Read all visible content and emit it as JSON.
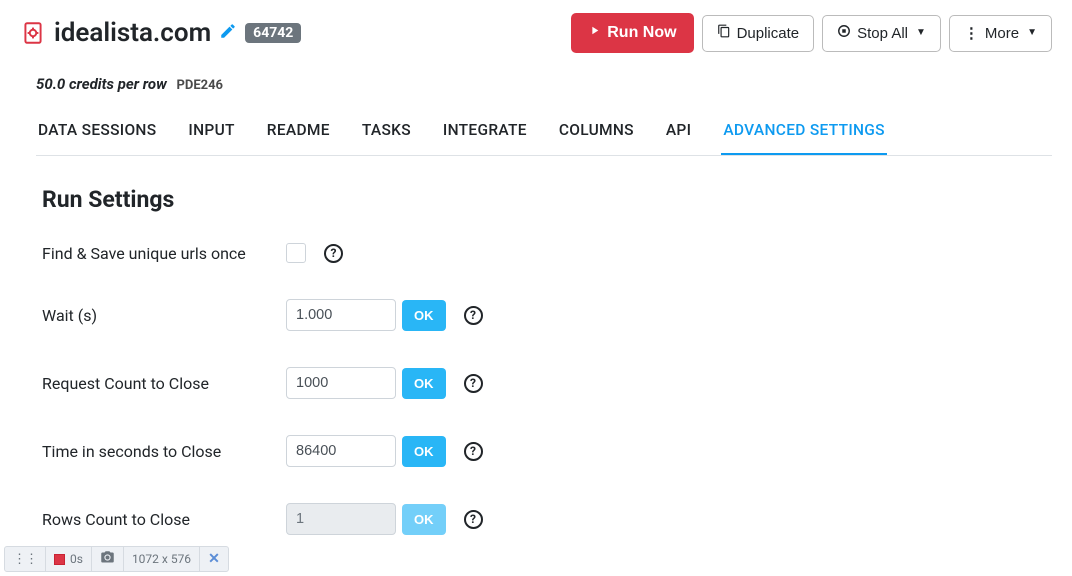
{
  "header": {
    "site_title": "idealista.com",
    "id_badge": "64742",
    "buttons": {
      "run_now": "Run Now",
      "duplicate": "Duplicate",
      "stop_all": "Stop All",
      "more": "More"
    }
  },
  "credits": {
    "text": "50.0 credits per row",
    "code": "PDE246"
  },
  "tabs": [
    {
      "id": "data-sessions",
      "label": "DATA SESSIONS",
      "active": false
    },
    {
      "id": "input",
      "label": "INPUT",
      "active": false
    },
    {
      "id": "readme",
      "label": "README",
      "active": false
    },
    {
      "id": "tasks",
      "label": "TASKS",
      "active": false
    },
    {
      "id": "integrate",
      "label": "INTEGRATE",
      "active": false
    },
    {
      "id": "columns",
      "label": "COLUMNS",
      "active": false
    },
    {
      "id": "api",
      "label": "API",
      "active": false
    },
    {
      "id": "advanced-settings",
      "label": "ADVANCED SETTINGS",
      "active": true
    }
  ],
  "settings": {
    "section_title": "Run Settings",
    "ok_label": "OK",
    "rows": [
      {
        "id": "find-save",
        "label": "Find & Save unique urls once",
        "type": "checkbox",
        "value": false
      },
      {
        "id": "wait",
        "label": "Wait (s)",
        "type": "text",
        "value": "1.000",
        "disabled": false
      },
      {
        "id": "request-count",
        "label": "Request Count to Close",
        "type": "text",
        "value": "1000",
        "disabled": false
      },
      {
        "id": "time-close",
        "label": "Time in seconds to Close",
        "type": "text",
        "value": "86400",
        "disabled": false
      },
      {
        "id": "rows-count",
        "label": "Rows Count to Close",
        "type": "text",
        "value": "1",
        "disabled": true
      }
    ]
  },
  "status_bar": {
    "time": "0s",
    "dimensions": "1072 x 576"
  }
}
